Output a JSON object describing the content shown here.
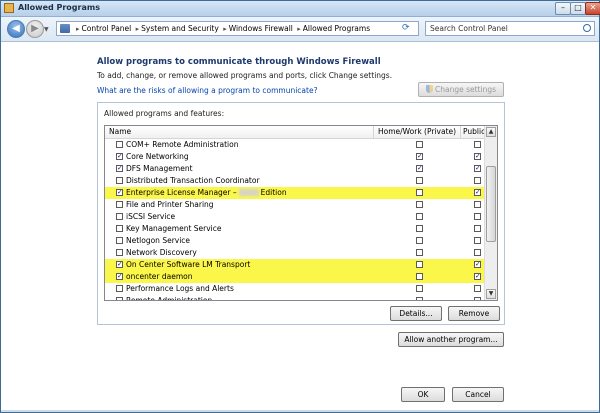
{
  "window": {
    "title": "Allowed Programs"
  },
  "address": {
    "breadcrumbs": [
      "Control Panel",
      "System and Security",
      "Windows Firewall",
      "Allowed Programs"
    ],
    "search_placeholder": "Search Control Panel"
  },
  "content": {
    "heading": "Allow programs to communicate through Windows Firewall",
    "subheading": "To add, change, or remove allowed programs and ports, click Change settings.",
    "risk_link": "What are the risks of allowing a program to communicate?",
    "change_settings_label": "Change settings",
    "panel_label": "Allowed programs and features:",
    "columns": {
      "name": "Name",
      "home": "Home/Work (Private)",
      "public": "Public"
    },
    "programs": [
      {
        "name": "COM+ Remote Administration",
        "enabled": false,
        "home": false,
        "public": false,
        "highlight": false
      },
      {
        "name": "Core Networking",
        "enabled": true,
        "home": true,
        "public": true,
        "highlight": false
      },
      {
        "name": "DFS Management",
        "enabled": true,
        "home": true,
        "public": true,
        "highlight": false
      },
      {
        "name": "Distributed Transaction Coordinator",
        "enabled": false,
        "home": false,
        "public": false,
        "highlight": false
      },
      {
        "name": "Enterprise License Manager –",
        "name_suffix": "Edition",
        "enabled": true,
        "home": false,
        "public": true,
        "highlight": true
      },
      {
        "name": "File and Printer Sharing",
        "enabled": false,
        "home": false,
        "public": false,
        "highlight": false
      },
      {
        "name": "iSCSI Service",
        "enabled": false,
        "home": false,
        "public": false,
        "highlight": false
      },
      {
        "name": "Key Management Service",
        "enabled": false,
        "home": false,
        "public": false,
        "highlight": false
      },
      {
        "name": "Netlogon Service",
        "enabled": false,
        "home": false,
        "public": false,
        "highlight": false
      },
      {
        "name": "Network Discovery",
        "enabled": false,
        "home": false,
        "public": false,
        "highlight": false
      },
      {
        "name": "On Center Software LM Transport",
        "enabled": true,
        "home": false,
        "public": true,
        "highlight": true
      },
      {
        "name": "oncenter daemon",
        "enabled": true,
        "home": false,
        "public": true,
        "highlight": true
      },
      {
        "name": "Performance Logs and Alerts",
        "enabled": false,
        "home": false,
        "public": false,
        "highlight": false
      },
      {
        "name": "Remote Administration",
        "enabled": false,
        "home": false,
        "public": false,
        "highlight": false
      }
    ],
    "details_label": "Details...",
    "remove_label": "Remove",
    "allow_another_label": "Allow another program...",
    "ok_label": "OK",
    "cancel_label": "Cancel"
  },
  "colors": {
    "highlight": "#fbf64a",
    "link": "#0645ad",
    "heading": "#1e3a6e"
  }
}
